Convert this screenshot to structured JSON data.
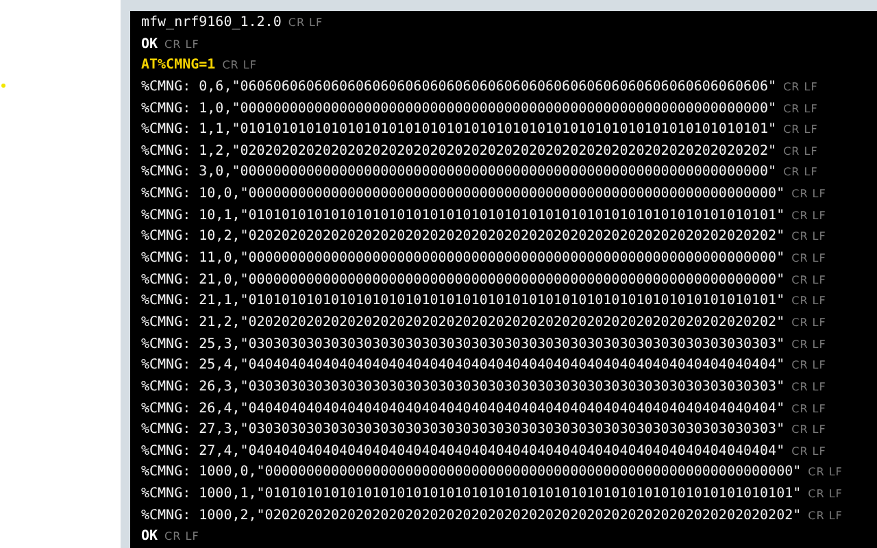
{
  "terminal": {
    "lines": [
      {
        "kind": "response",
        "text": "mfw_nrf9160_1.2.0",
        "eol": "CR LF"
      },
      {
        "kind": "status",
        "text": "OK",
        "eol": "CR LF"
      },
      {
        "kind": "command",
        "text": "AT%CMNG=1",
        "eol": "CR LF"
      },
      {
        "kind": "response",
        "text": "%CMNG: 0,6,\"0606060606060606060606060606060606060606060606060606060606060606\"",
        "eol": "CR LF"
      },
      {
        "kind": "response",
        "text": "%CMNG: 1,0,\"0000000000000000000000000000000000000000000000000000000000000000\"",
        "eol": "CR LF"
      },
      {
        "kind": "response",
        "text": "%CMNG: 1,1,\"0101010101010101010101010101010101010101010101010101010101010101\"",
        "eol": "CR LF"
      },
      {
        "kind": "response",
        "text": "%CMNG: 1,2,\"0202020202020202020202020202020202020202020202020202020202020202\"",
        "eol": "CR LF"
      },
      {
        "kind": "response",
        "text": "%CMNG: 3,0,\"0000000000000000000000000000000000000000000000000000000000000000\"",
        "eol": "CR LF"
      },
      {
        "kind": "response",
        "text": "%CMNG: 10,0,\"0000000000000000000000000000000000000000000000000000000000000000\"",
        "eol": "CR LF"
      },
      {
        "kind": "response",
        "text": "%CMNG: 10,1,\"0101010101010101010101010101010101010101010101010101010101010101\"",
        "eol": "CR LF"
      },
      {
        "kind": "response",
        "text": "%CMNG: 10,2,\"0202020202020202020202020202020202020202020202020202020202020202\"",
        "eol": "CR LF"
      },
      {
        "kind": "response",
        "text": "%CMNG: 11,0,\"0000000000000000000000000000000000000000000000000000000000000000\"",
        "eol": "CR LF"
      },
      {
        "kind": "response",
        "text": "%CMNG: 21,0,\"0000000000000000000000000000000000000000000000000000000000000000\"",
        "eol": "CR LF"
      },
      {
        "kind": "response",
        "text": "%CMNG: 21,1,\"0101010101010101010101010101010101010101010101010101010101010101\"",
        "eol": "CR LF"
      },
      {
        "kind": "response",
        "text": "%CMNG: 21,2,\"0202020202020202020202020202020202020202020202020202020202020202\"",
        "eol": "CR LF"
      },
      {
        "kind": "response",
        "text": "%CMNG: 25,3,\"0303030303030303030303030303030303030303030303030303030303030303\"",
        "eol": "CR LF"
      },
      {
        "kind": "response",
        "text": "%CMNG: 25,4,\"0404040404040404040404040404040404040404040404040404040404040404\"",
        "eol": "CR LF"
      },
      {
        "kind": "response",
        "text": "%CMNG: 26,3,\"0303030303030303030303030303030303030303030303030303030303030303\"",
        "eol": "CR LF"
      },
      {
        "kind": "response",
        "text": "%CMNG: 26,4,\"0404040404040404040404040404040404040404040404040404040404040404\"",
        "eol": "CR LF"
      },
      {
        "kind": "response",
        "text": "%CMNG: 27,3,\"0303030303030303030303030303030303030303030303030303030303030303\"",
        "eol": "CR LF"
      },
      {
        "kind": "response",
        "text": "%CMNG: 27,4,\"0404040404040404040404040404040404040404040404040404040404040404\"",
        "eol": "CR LF"
      },
      {
        "kind": "response",
        "text": "%CMNG: 1000,0,\"0000000000000000000000000000000000000000000000000000000000000000\"",
        "eol": "CR LF"
      },
      {
        "kind": "response",
        "text": "%CMNG: 1000,1,\"0101010101010101010101010101010101010101010101010101010101010101\"",
        "eol": "CR LF"
      },
      {
        "kind": "response",
        "text": "%CMNG: 1000,2,\"0202020202020202020202020202020202020202020202020202020202020202\"",
        "eol": "CR LF"
      },
      {
        "kind": "status",
        "text": "OK",
        "eol": "CR LF"
      }
    ]
  }
}
